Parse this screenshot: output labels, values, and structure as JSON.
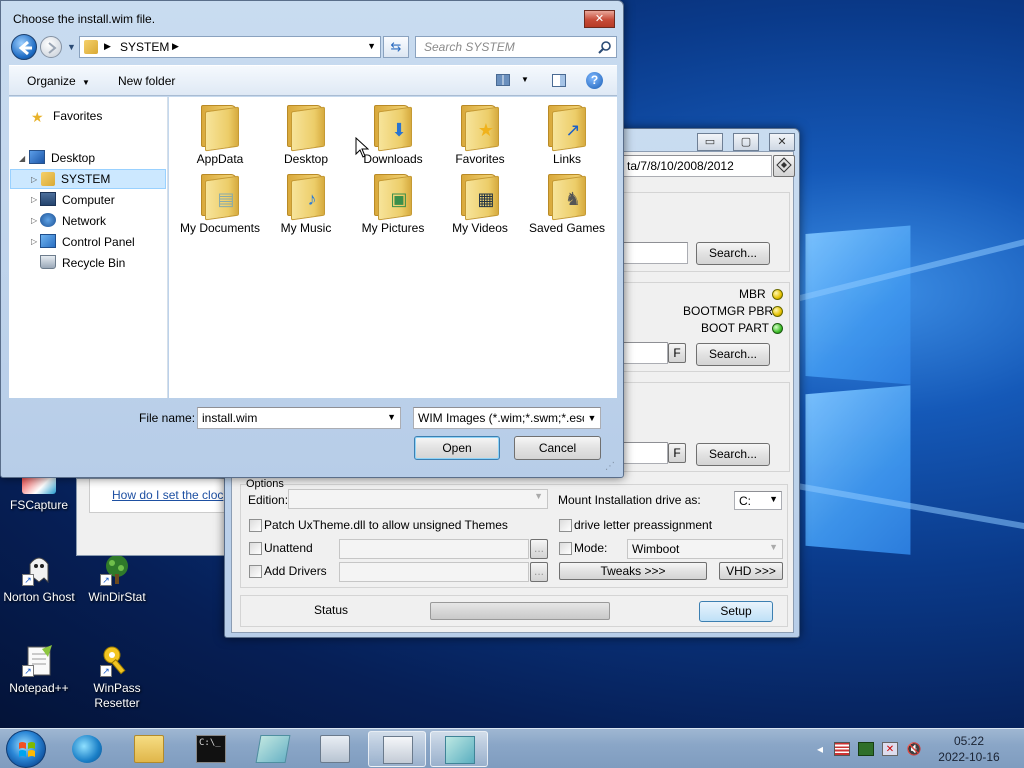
{
  "colors": {
    "accent": "#3c7fb1",
    "desktop_bg": "#0a3a8a",
    "selection": "#cce8ff"
  },
  "desktop": {
    "icons": [
      {
        "label": "FSCapture",
        "icon": "fscapture-icon"
      },
      {
        "label": "Norton Ghost",
        "icon": "ghost-icon"
      },
      {
        "label": "WinDirStat",
        "icon": "windirstat-icon"
      },
      {
        "label": "Notepad++",
        "icon": "notepadpp-icon"
      },
      {
        "label": "WinPass Resetter",
        "icon": "key-icon"
      }
    ]
  },
  "help_window": {
    "link": "How do I set the cloc"
  },
  "installer": {
    "os_list": "ta/7/8/10/2008/2012",
    "search_label": "Search...",
    "mbr_label": "MBR",
    "bootmgr_label": "BOOTMGR PBR",
    "bootpart_label": "BOOT PART",
    "f_label": "F",
    "options_label": "Options",
    "edition_label": "Edition:",
    "mount_label": "Mount Installation drive as:",
    "mount_value": "C:",
    "patch_label": "Patch UxTheme.dll to allow unsigned Themes",
    "preassign_label": "drive letter preassignment",
    "unattend_label": "Unattend",
    "mode_label": "Mode:",
    "mode_value": "Wimboot",
    "add_drivers_label": "Add Drivers",
    "browse_label": "...",
    "tweaks_label": "Tweaks >>>",
    "vhd_label": "VHD >>>",
    "status_label": "Status",
    "setup_label": "Setup"
  },
  "dialog": {
    "title": "Choose the install.wim file.",
    "close_label": "✕",
    "breadcrumb": "SYSTEM",
    "search_placeholder": "Search SYSTEM",
    "organize_label": "Organize",
    "new_folder_label": "New folder",
    "tree": [
      {
        "label": "Favorites",
        "icon": "star-icon"
      },
      {
        "label": "Desktop",
        "icon": "desktop-icon"
      },
      {
        "label": "SYSTEM",
        "icon": "user-folder-icon"
      },
      {
        "label": "Computer",
        "icon": "computer-icon"
      },
      {
        "label": "Network",
        "icon": "network-icon"
      },
      {
        "label": "Control Panel",
        "icon": "control-panel-icon"
      },
      {
        "label": "Recycle Bin",
        "icon": "recycle-bin-icon"
      }
    ],
    "folders": [
      {
        "label": "AppData",
        "icon": "folder-icon"
      },
      {
        "label": "Desktop",
        "icon": "folder-desktop-icon"
      },
      {
        "label": "Downloads",
        "icon": "folder-downloads-icon"
      },
      {
        "label": "Favorites",
        "icon": "folder-favorites-icon"
      },
      {
        "label": "Links",
        "icon": "folder-links-icon"
      },
      {
        "label": "My Documents",
        "icon": "folder-documents-icon"
      },
      {
        "label": "My Music",
        "icon": "folder-music-icon"
      },
      {
        "label": "My Pictures",
        "icon": "folder-pictures-icon"
      },
      {
        "label": "My Videos",
        "icon": "folder-videos-icon"
      },
      {
        "label": "Saved Games",
        "icon": "folder-games-icon"
      }
    ],
    "file_name_label": "File name:",
    "file_name_value": "install.wim",
    "file_type_value": "WIM Images (*.wim;*.swm;*.esd)",
    "open_label": "Open",
    "cancel_label": "Cancel"
  },
  "taskbar": {
    "clock_time": "05:22",
    "clock_date": "2022-10-16"
  }
}
